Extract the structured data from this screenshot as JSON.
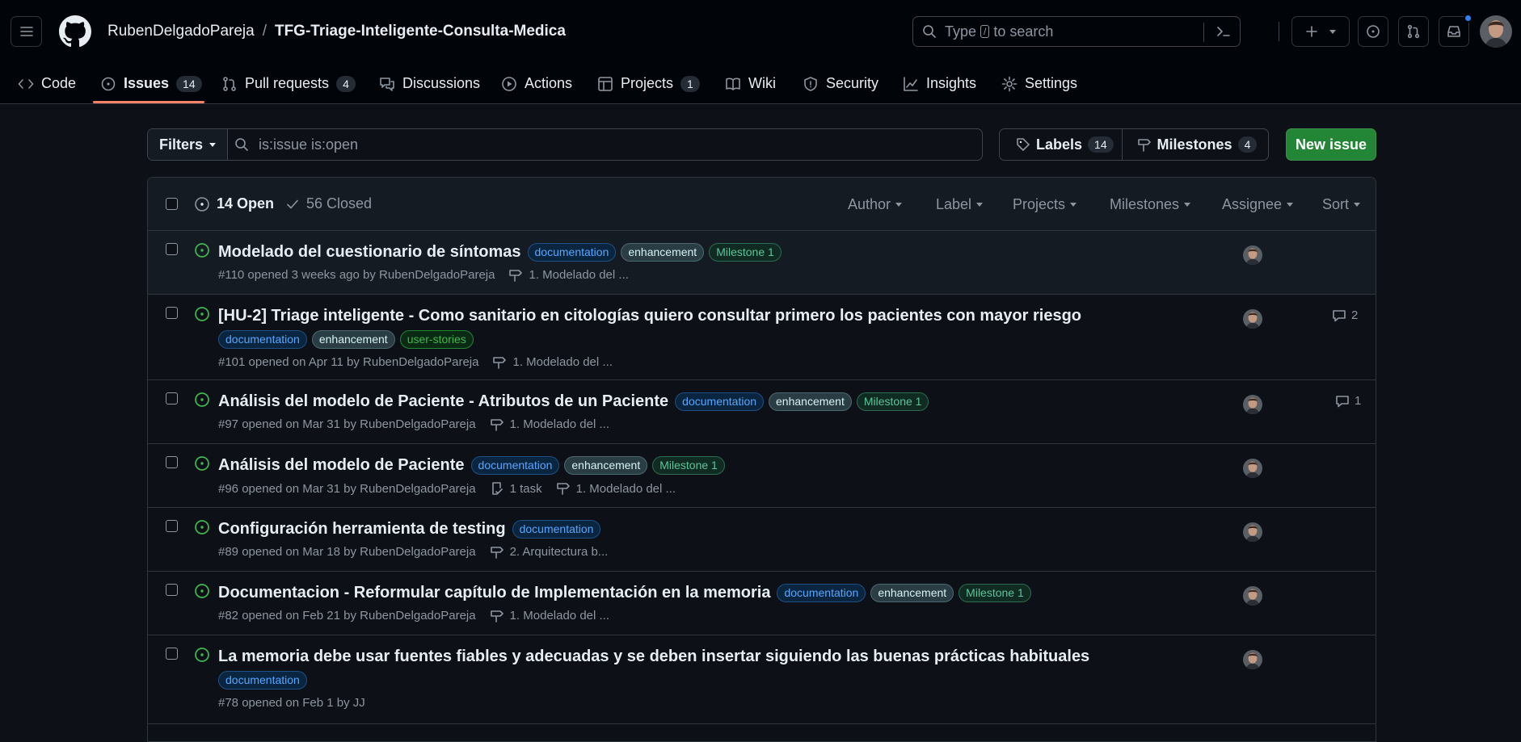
{
  "repo": {
    "owner": "RubenDelgadoPareja",
    "separator": "/",
    "name": "TFG-Triage-Inteligente-Consulta-Medica"
  },
  "search": {
    "prefix": "Type",
    "key": "/",
    "suffix": "to search"
  },
  "nav": {
    "tabs": [
      {
        "label": "Code",
        "icon": "code-icon"
      },
      {
        "label": "Issues",
        "count": "14",
        "icon": "issue-opened-icon",
        "active": true
      },
      {
        "label": "Pull requests",
        "count": "4",
        "icon": "git-pull-request-icon"
      },
      {
        "label": "Discussions",
        "icon": "comment-discussion-icon"
      },
      {
        "label": "Actions",
        "icon": "play-icon"
      },
      {
        "label": "Projects",
        "count": "1",
        "icon": "table-icon"
      },
      {
        "label": "Wiki",
        "icon": "book-icon"
      },
      {
        "label": "Security",
        "icon": "shield-icon"
      },
      {
        "label": "Insights",
        "icon": "graph-icon"
      },
      {
        "label": "Settings",
        "icon": "gear-icon"
      }
    ]
  },
  "filters": {
    "button_label": "Filters",
    "query": "is:issue is:open",
    "labels_label": "Labels",
    "labels_count": "14",
    "milestones_label": "Milestones",
    "milestones_count": "4",
    "new_issue_label": "New issue"
  },
  "list_header": {
    "open_label": "14 Open",
    "closed_label": "56 Closed",
    "sort_options": [
      "Author",
      "Label",
      "Projects",
      "Milestones",
      "Assignee",
      "Sort"
    ]
  },
  "issues": [
    {
      "title": "Modelado del cuestionario de síntomas",
      "labels": [
        "documentation",
        "enhancement",
        "Milestone 1"
      ],
      "meta": "#110 opened 3 weeks ago by RubenDelgadoPareja",
      "milestone": "1. Modelado del ..."
    },
    {
      "title": "[HU-2] Triage inteligente - Como sanitario en citologías quiero consultar primero los pacientes con mayor riesgo",
      "labels": [
        "documentation",
        "enhancement",
        "user-stories"
      ],
      "meta": "#101 opened on Apr 11 by RubenDelgadoPareja",
      "milestone": "1. Modelado del ...",
      "comments": "2"
    },
    {
      "title": "Análisis del modelo de Paciente - Atributos de un Paciente",
      "labels": [
        "documentation",
        "enhancement",
        "Milestone 1"
      ],
      "meta": "#97 opened on Mar 31 by RubenDelgadoPareja",
      "milestone": "1. Modelado del ...",
      "comments": "1"
    },
    {
      "title": "Análisis del modelo de Paciente",
      "labels": [
        "documentation",
        "enhancement",
        "Milestone 1"
      ],
      "meta": "#96 opened on Mar 31 by RubenDelgadoPareja",
      "tasks": "1 task",
      "milestone": "1. Modelado del ..."
    },
    {
      "title": "Configuración herramienta de testing",
      "labels": [
        "documentation"
      ],
      "meta": "#89 opened on Mar 18 by RubenDelgadoPareja",
      "milestone": "2. Arquitectura b..."
    },
    {
      "title": "Documentacion - Reformular capítulo de Implementación en la memoria",
      "labels": [
        "documentation",
        "enhancement",
        "Milestone 1"
      ],
      "meta": "#82 opened on Feb 21 by RubenDelgadoPareja",
      "milestone": "1. Modelado del ..."
    },
    {
      "title": "La memoria debe usar fuentes fiables y adecuadas y se deben insertar siguiendo las buenas prácticas habituales",
      "labels": [
        "documentation"
      ],
      "meta": "#78 opened on Feb 1 by JJ"
    }
  ],
  "colors": {
    "background": "#0d1117",
    "header": "#010409",
    "open_green": "#3fb950",
    "new_issue_green": "#238636",
    "nav_underline": "#f78166",
    "notification_blue": "#2f81f7"
  }
}
